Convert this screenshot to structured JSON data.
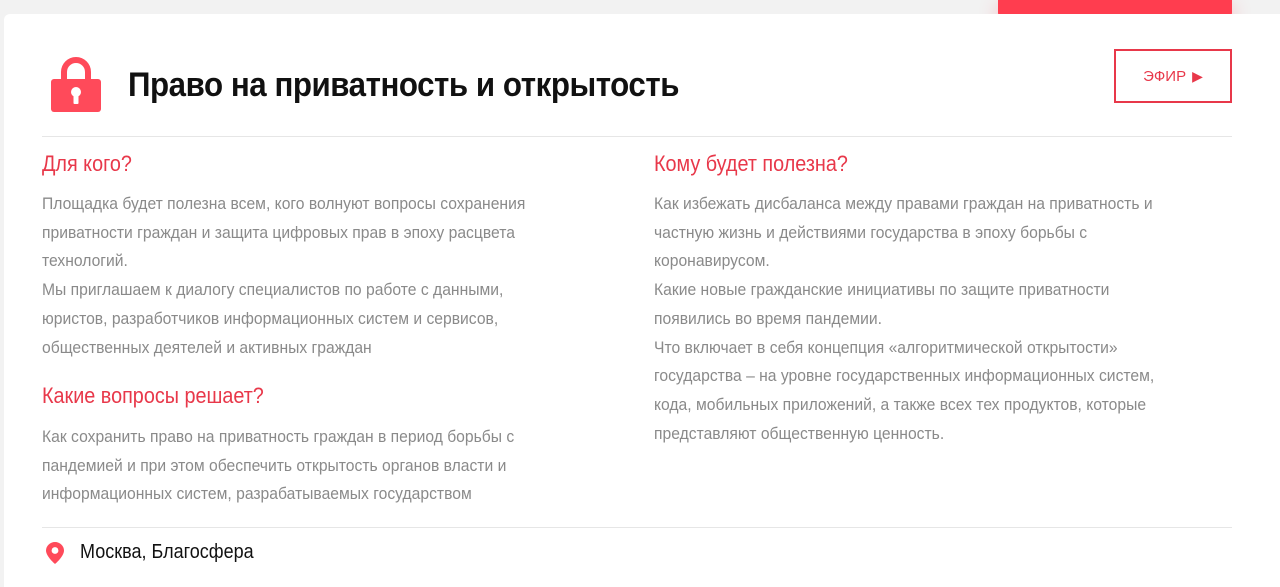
{
  "colors": {
    "accent": "#e8384a",
    "text": "#111111",
    "muted": "#8a8a8a"
  },
  "header": {
    "title": "Право на приватность и открытость",
    "title_icon": "lock-icon",
    "efir_button": {
      "label": "ЭФИР",
      "icon": "play-icon",
      "icon_glyph": "▶"
    }
  },
  "left": {
    "for_whom": {
      "heading": "Для кого?",
      "lines": [
        "Площадка будет полезна всем, кого волнуют вопросы сохранения",
        "приватности граждан и защита цифровых прав в эпоху расцвета",
        "технологий.",
        "Мы приглашаем к диалогу специалистов по работе с данными,",
        "юристов, разработчиков информационных систем и сервисов,",
        "общественных деятелей и активных граждан"
      ]
    },
    "questions": {
      "heading": "Какие вопросы решает?",
      "lines": [
        "Как сохранить право на приватность граждан в период борьбы с",
        "пандемией и при этом обеспечить открытость органов власти и",
        "информационных систем, разрабатываемых государством"
      ]
    }
  },
  "right": {
    "useful_for": {
      "heading": "Кому будет полезна?",
      "lines": [
        "Как избежать дисбаланса между правами граждан на приватность и",
        "частную жизнь и действиями государства в эпоху борьбы с",
        "коронавирусом.",
        "Какие новые гражданские инициативы по защите приватности",
        "появились во время пандемии.",
        "Что включает в себя концепция «алгоритмической открытости»",
        "государства – на уровне государственных информационных систем,",
        "кода, мобильных приложений, а также всех тех продуктов, которые",
        "представляют общественную ценность."
      ]
    }
  },
  "footer": {
    "location_icon": "map-pin-icon",
    "location": "Москва, Благосфера"
  }
}
